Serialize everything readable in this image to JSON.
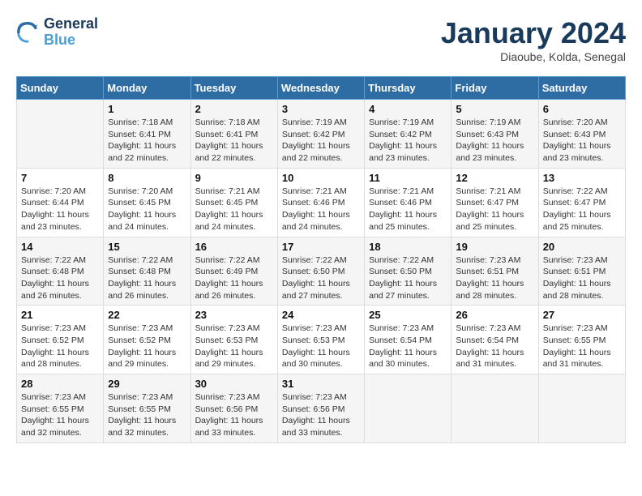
{
  "header": {
    "logo_line1": "General",
    "logo_line2": "Blue",
    "month": "January 2024",
    "location": "Diaoube, Kolda, Senegal"
  },
  "days_of_week": [
    "Sunday",
    "Monday",
    "Tuesday",
    "Wednesday",
    "Thursday",
    "Friday",
    "Saturday"
  ],
  "weeks": [
    [
      {
        "day": "",
        "detail": ""
      },
      {
        "day": "1",
        "detail": "Sunrise: 7:18 AM\nSunset: 6:41 PM\nDaylight: 11 hours\nand 22 minutes."
      },
      {
        "day": "2",
        "detail": "Sunrise: 7:18 AM\nSunset: 6:41 PM\nDaylight: 11 hours\nand 22 minutes."
      },
      {
        "day": "3",
        "detail": "Sunrise: 7:19 AM\nSunset: 6:42 PM\nDaylight: 11 hours\nand 22 minutes."
      },
      {
        "day": "4",
        "detail": "Sunrise: 7:19 AM\nSunset: 6:42 PM\nDaylight: 11 hours\nand 23 minutes."
      },
      {
        "day": "5",
        "detail": "Sunrise: 7:19 AM\nSunset: 6:43 PM\nDaylight: 11 hours\nand 23 minutes."
      },
      {
        "day": "6",
        "detail": "Sunrise: 7:20 AM\nSunset: 6:43 PM\nDaylight: 11 hours\nand 23 minutes."
      }
    ],
    [
      {
        "day": "7",
        "detail": "Sunrise: 7:20 AM\nSunset: 6:44 PM\nDaylight: 11 hours\nand 23 minutes."
      },
      {
        "day": "8",
        "detail": "Sunrise: 7:20 AM\nSunset: 6:45 PM\nDaylight: 11 hours\nand 24 minutes."
      },
      {
        "day": "9",
        "detail": "Sunrise: 7:21 AM\nSunset: 6:45 PM\nDaylight: 11 hours\nand 24 minutes."
      },
      {
        "day": "10",
        "detail": "Sunrise: 7:21 AM\nSunset: 6:46 PM\nDaylight: 11 hours\nand 24 minutes."
      },
      {
        "day": "11",
        "detail": "Sunrise: 7:21 AM\nSunset: 6:46 PM\nDaylight: 11 hours\nand 25 minutes."
      },
      {
        "day": "12",
        "detail": "Sunrise: 7:21 AM\nSunset: 6:47 PM\nDaylight: 11 hours\nand 25 minutes."
      },
      {
        "day": "13",
        "detail": "Sunrise: 7:22 AM\nSunset: 6:47 PM\nDaylight: 11 hours\nand 25 minutes."
      }
    ],
    [
      {
        "day": "14",
        "detail": "Sunrise: 7:22 AM\nSunset: 6:48 PM\nDaylight: 11 hours\nand 26 minutes."
      },
      {
        "day": "15",
        "detail": "Sunrise: 7:22 AM\nSunset: 6:48 PM\nDaylight: 11 hours\nand 26 minutes."
      },
      {
        "day": "16",
        "detail": "Sunrise: 7:22 AM\nSunset: 6:49 PM\nDaylight: 11 hours\nand 26 minutes."
      },
      {
        "day": "17",
        "detail": "Sunrise: 7:22 AM\nSunset: 6:50 PM\nDaylight: 11 hours\nand 27 minutes."
      },
      {
        "day": "18",
        "detail": "Sunrise: 7:22 AM\nSunset: 6:50 PM\nDaylight: 11 hours\nand 27 minutes."
      },
      {
        "day": "19",
        "detail": "Sunrise: 7:23 AM\nSunset: 6:51 PM\nDaylight: 11 hours\nand 28 minutes."
      },
      {
        "day": "20",
        "detail": "Sunrise: 7:23 AM\nSunset: 6:51 PM\nDaylight: 11 hours\nand 28 minutes."
      }
    ],
    [
      {
        "day": "21",
        "detail": "Sunrise: 7:23 AM\nSunset: 6:52 PM\nDaylight: 11 hours\nand 28 minutes."
      },
      {
        "day": "22",
        "detail": "Sunrise: 7:23 AM\nSunset: 6:52 PM\nDaylight: 11 hours\nand 29 minutes."
      },
      {
        "day": "23",
        "detail": "Sunrise: 7:23 AM\nSunset: 6:53 PM\nDaylight: 11 hours\nand 29 minutes."
      },
      {
        "day": "24",
        "detail": "Sunrise: 7:23 AM\nSunset: 6:53 PM\nDaylight: 11 hours\nand 30 minutes."
      },
      {
        "day": "25",
        "detail": "Sunrise: 7:23 AM\nSunset: 6:54 PM\nDaylight: 11 hours\nand 30 minutes."
      },
      {
        "day": "26",
        "detail": "Sunrise: 7:23 AM\nSunset: 6:54 PM\nDaylight: 11 hours\nand 31 minutes."
      },
      {
        "day": "27",
        "detail": "Sunrise: 7:23 AM\nSunset: 6:55 PM\nDaylight: 11 hours\nand 31 minutes."
      }
    ],
    [
      {
        "day": "28",
        "detail": "Sunrise: 7:23 AM\nSunset: 6:55 PM\nDaylight: 11 hours\nand 32 minutes."
      },
      {
        "day": "29",
        "detail": "Sunrise: 7:23 AM\nSunset: 6:55 PM\nDaylight: 11 hours\nand 32 minutes."
      },
      {
        "day": "30",
        "detail": "Sunrise: 7:23 AM\nSunset: 6:56 PM\nDaylight: 11 hours\nand 33 minutes."
      },
      {
        "day": "31",
        "detail": "Sunrise: 7:23 AM\nSunset: 6:56 PM\nDaylight: 11 hours\nand 33 minutes."
      },
      {
        "day": "",
        "detail": ""
      },
      {
        "day": "",
        "detail": ""
      },
      {
        "day": "",
        "detail": ""
      }
    ]
  ]
}
